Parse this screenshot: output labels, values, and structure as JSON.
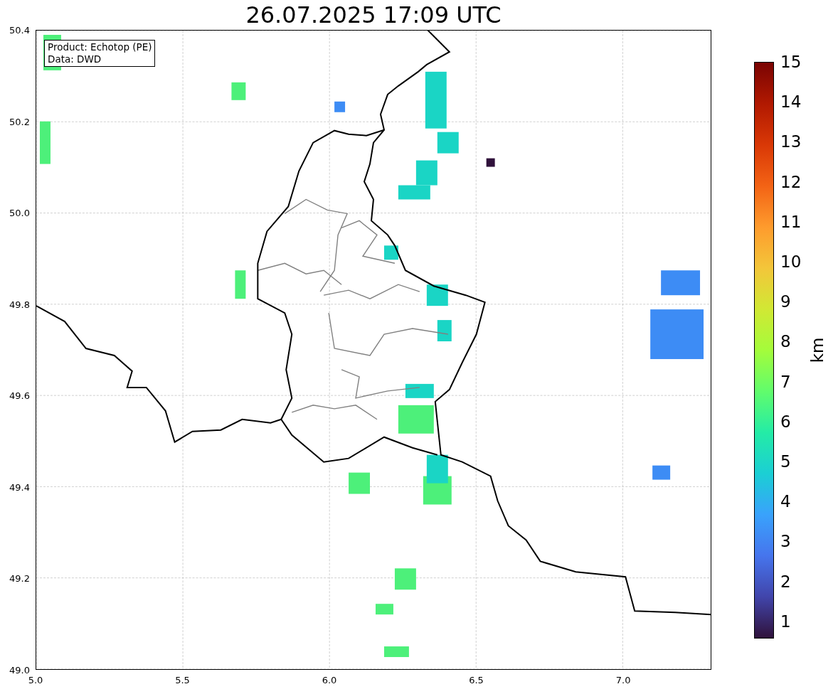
{
  "title": "26.07.2025 17:09 UTC",
  "legend": [
    "Product: Echotop (PE)",
    "Data: DWD"
  ],
  "y_ticks": [
    "50.4",
    "50.2",
    "50.0",
    "49.8",
    "49.6",
    "49.4",
    "49.2",
    "49.0"
  ],
  "x_ticks": [
    "5.0",
    "5.5",
    "6.0",
    "6.5",
    "7.0"
  ],
  "colorbar": {
    "ticks": [
      "15",
      "14",
      "13",
      "12",
      "11",
      "10",
      "9",
      "8",
      "7",
      "6",
      "5",
      "4",
      "3",
      "2",
      "1"
    ],
    "label": "km"
  }
}
